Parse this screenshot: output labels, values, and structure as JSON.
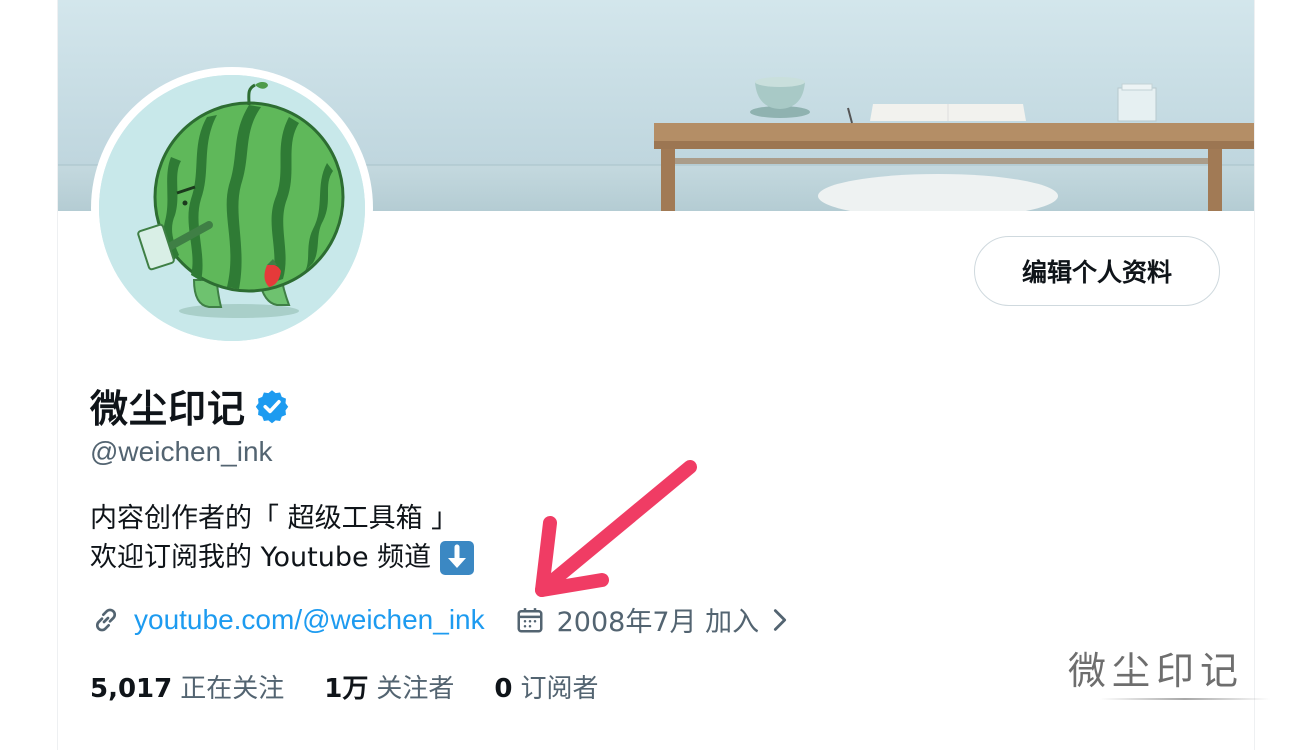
{
  "profile": {
    "edit_button": "编辑个人资料",
    "display_name": "微尘印记",
    "handle": "@weichen_ink",
    "bio_line1": "内容创作者的「 超级工具箱 」",
    "bio_line2": "欢迎订阅我的 Youtube 频道",
    "website": "youtube.com/@weichen_ink",
    "joined": "2008年7月 加入",
    "verified_color": "#1d9bf0",
    "link_color": "#1d9bf0"
  },
  "stats": [
    {
      "count": "5,017",
      "label": "正在关注"
    },
    {
      "count": "1万",
      "label": "关注者"
    },
    {
      "count": "0",
      "label": "订阅者"
    }
  ],
  "watermark": "微尘印记",
  "icons": [
    "verified-badge-icon",
    "down-arrow-emoji-icon",
    "link-icon",
    "calendar-icon",
    "chevron-right-icon"
  ],
  "annotation_arrow_color": "#f03c64"
}
